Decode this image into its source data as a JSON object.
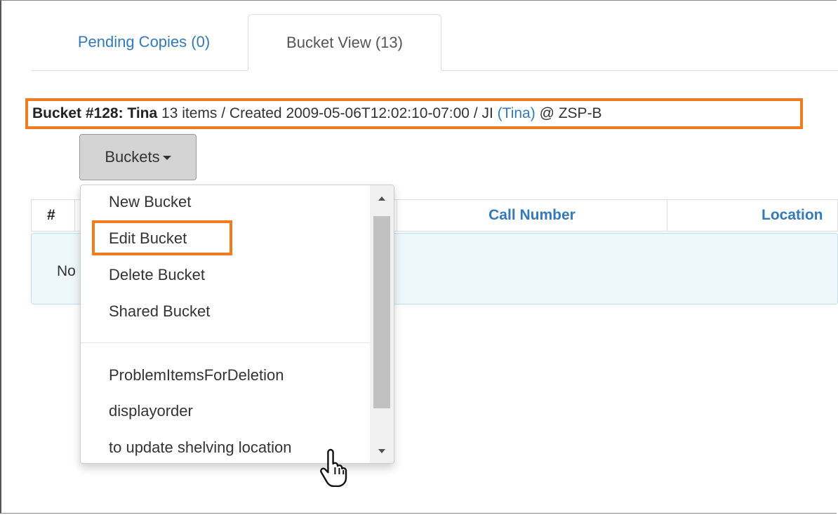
{
  "tabs": [
    {
      "label": "Pending Copies (0)",
      "active": false
    },
    {
      "label": "Bucket View (13)",
      "active": true
    }
  ],
  "bucket_info": {
    "heading": "Bucket #128: Tina",
    "summary": " 13 items / Created 2009-05-06T12:02:10-07:00 / JI ",
    "owner": "(Tina)",
    "location": " @ ZSP-B"
  },
  "buckets_button": {
    "label": "Buckets"
  },
  "table": {
    "columns": [
      "#",
      "Call Number",
      "Location"
    ],
    "empty_text": "No"
  },
  "dropdown": {
    "actions": [
      "New Bucket",
      "Edit Bucket",
      "Delete Bucket",
      "Shared Bucket"
    ],
    "buckets": [
      "ProblemItemsForDeletion",
      "displayorder",
      "to update shelving location"
    ],
    "highlighted": "Edit Bucket"
  },
  "colors": {
    "highlight": "#f07c22",
    "link": "#337ab7"
  },
  "icons": {
    "caret": "caret-down-icon",
    "cursor": "hand-pointer-icon"
  }
}
